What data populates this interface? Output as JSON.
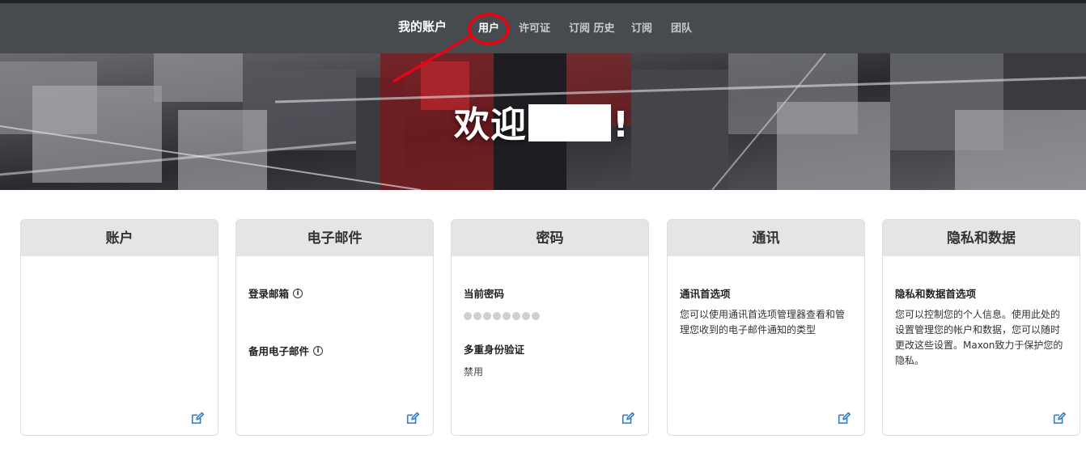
{
  "nav": {
    "title": "我的账户",
    "items": [
      {
        "label": "用户",
        "active": true
      },
      {
        "label": "许可证"
      },
      {
        "label": "订阅 历史"
      },
      {
        "label": "订阅"
      },
      {
        "label": "团队"
      }
    ]
  },
  "hero": {
    "welcome_prefix": "欢迎",
    "welcome_suffix": "!"
  },
  "cards": [
    {
      "title": "账户"
    },
    {
      "title": "电子邮件",
      "fields": [
        {
          "label": "登录邮箱"
        },
        {
          "label": "备用电子邮件"
        }
      ]
    },
    {
      "title": "密码",
      "fields": [
        {
          "label": "当前密码",
          "masked": true
        },
        {
          "label": "多重身份验证",
          "value": "禁用"
        }
      ]
    },
    {
      "title": "通讯",
      "fields": [
        {
          "label": "通讯首选项",
          "description": "您可以使用通讯首选项管理器查看和管理您收到的电子邮件通知的类型"
        }
      ]
    },
    {
      "title": "隐私和数据",
      "fields": [
        {
          "label": "隐私和数据首选项",
          "description": "您可以控制您的个人信息。使用此处的设置管理您的帐户和数据，您可以随时更改这些设置。Maxon致力于保护您的隐私。"
        }
      ]
    }
  ],
  "colors": {
    "topbar": "#454b4f",
    "annotation": "#e30613",
    "card_header": "#e5e5e5",
    "edit_icon": "#2f7ec7"
  },
  "icons": {
    "info": "info-circle-icon",
    "edit": "edit-pencil-icon"
  }
}
